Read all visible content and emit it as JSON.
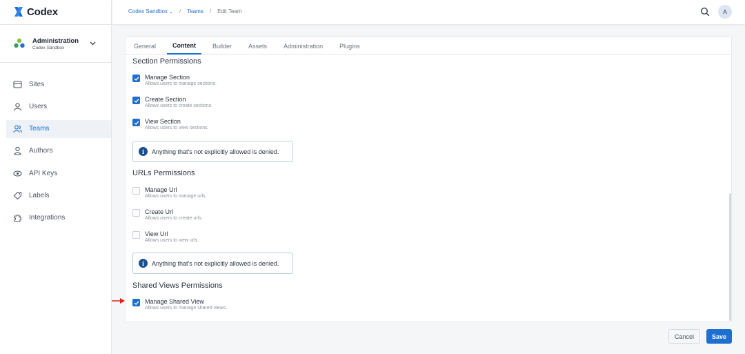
{
  "app": {
    "name": "Codex",
    "brand_color": "#1d6fd1"
  },
  "org": {
    "name": "Administration",
    "sub": "Codex Sandbox"
  },
  "nav": [
    {
      "label": "Sites",
      "icon": "browser-window-icon"
    },
    {
      "label": "Users",
      "icon": "user-icon"
    },
    {
      "label": "Teams",
      "icon": "users-icon",
      "active": true
    },
    {
      "label": "Authors",
      "icon": "author-icon"
    },
    {
      "label": "API Keys",
      "icon": "api-key-icon"
    },
    {
      "label": "Labels",
      "icon": "tag-icon"
    },
    {
      "label": "Integrations",
      "icon": "puzzle-icon"
    }
  ],
  "breadcrumb": {
    "org": "Codex Sandbox",
    "section": "Teams",
    "current": "Edit Team",
    "separator": "/"
  },
  "user": {
    "initial": "A"
  },
  "tabs": [
    "General",
    "Content",
    "Builder",
    "Assets",
    "Administration",
    "Plugins"
  ],
  "active_tab": "Content",
  "sections": [
    {
      "title": "Section Permissions",
      "items": [
        {
          "label": "Manage Section",
          "desc": "Allows users to manage sections.",
          "checked": true
        },
        {
          "label": "Create Section",
          "desc": "Allows users to create sections.",
          "checked": true
        },
        {
          "label": "View Section",
          "desc": "Allows users to view sections.",
          "checked": true
        }
      ],
      "notice": "Anything that's not explicitly allowed is denied."
    },
    {
      "title": "URLs Permissions",
      "items": [
        {
          "label": "Manage Url",
          "desc": "Allows users to manage urls.",
          "checked": false
        },
        {
          "label": "Create Url",
          "desc": "Allows users to create urls.",
          "checked": false
        },
        {
          "label": "View Url",
          "desc": "Allows users to view urls.",
          "checked": false
        }
      ],
      "notice": "Anything that's not explicitly allowed is denied."
    },
    {
      "title": "Shared Views Permissions",
      "items": [
        {
          "label": "Manage Shared View",
          "desc": "Allows users to manage shared views.",
          "checked": true
        }
      ]
    }
  ],
  "actions": {
    "cancel": "Cancel",
    "save": "Save"
  }
}
